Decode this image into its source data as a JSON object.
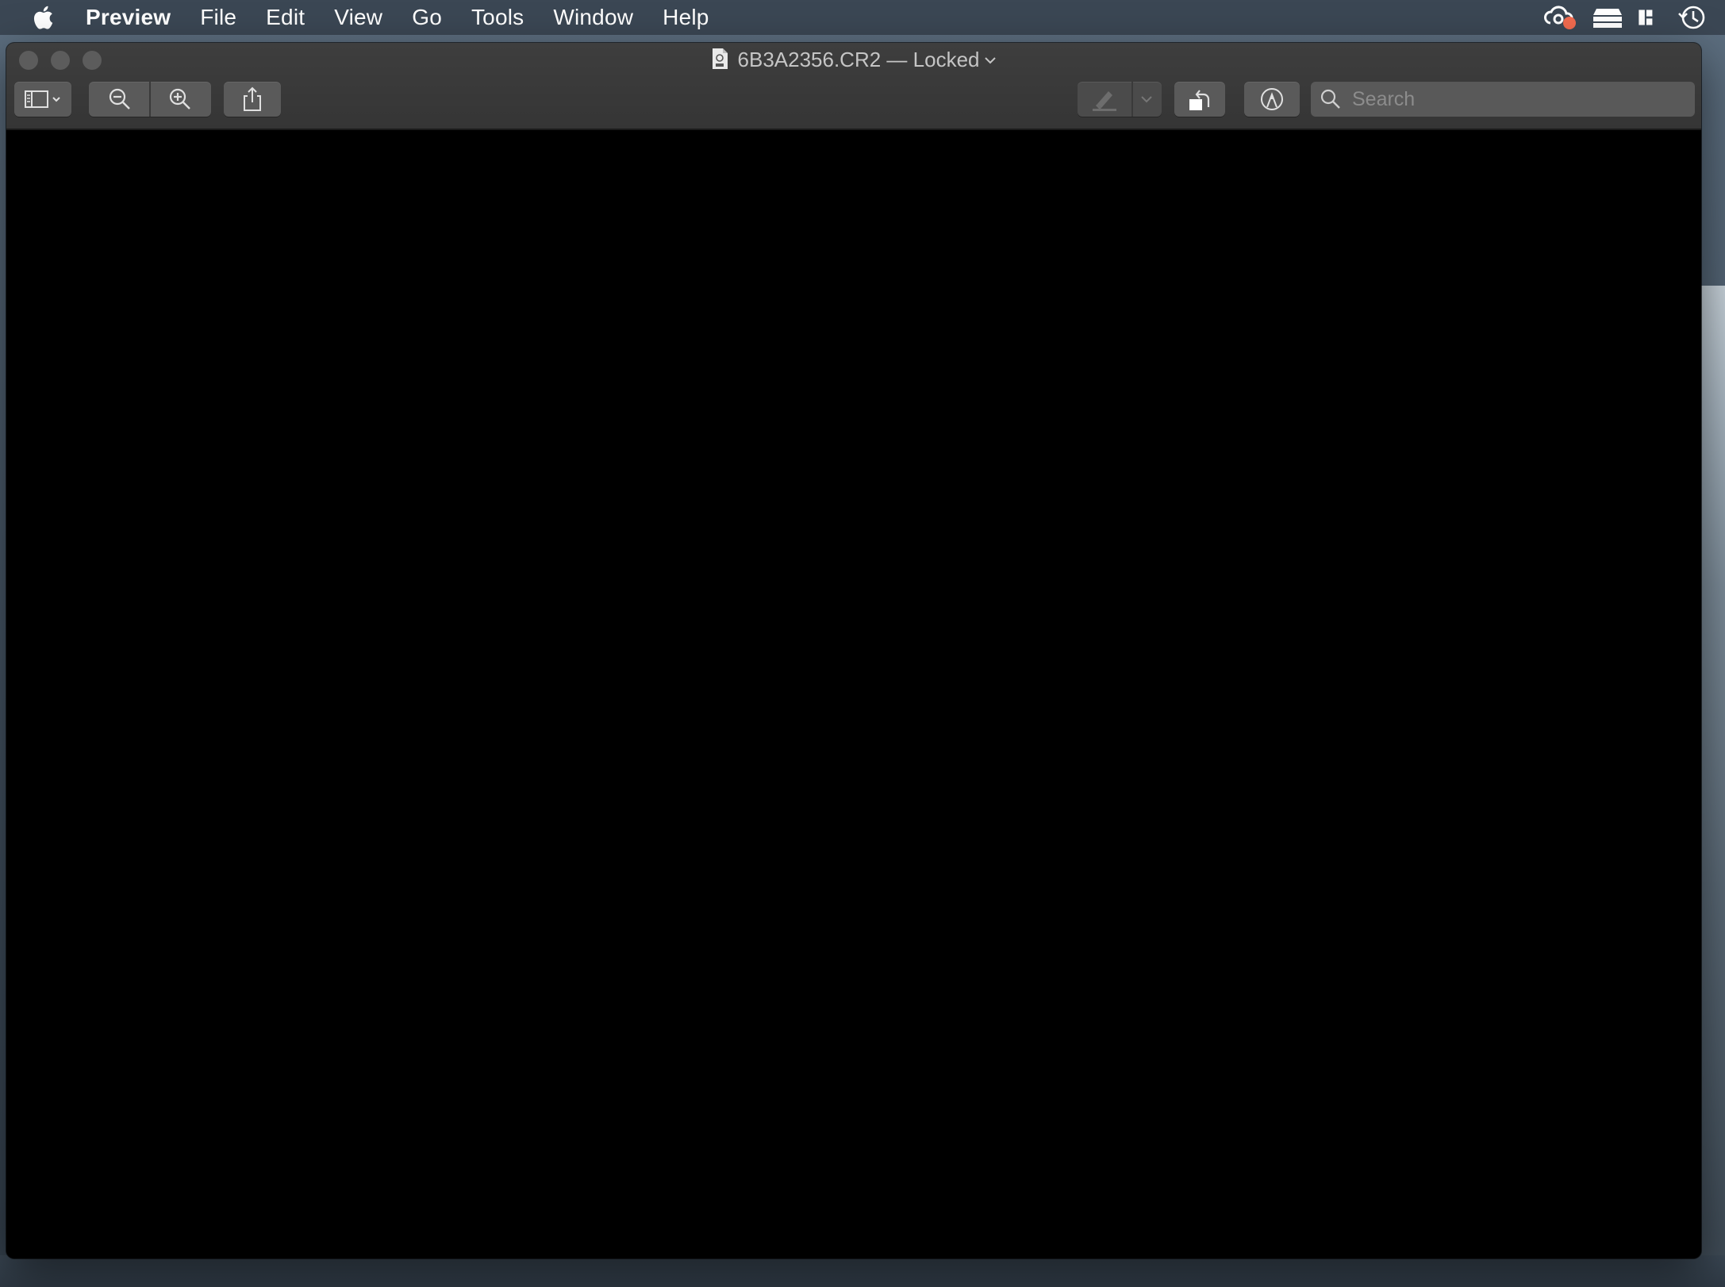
{
  "menubar": {
    "app_name": "Preview",
    "items": [
      "File",
      "Edit",
      "View",
      "Go",
      "Tools",
      "Window",
      "Help"
    ],
    "status_icons": [
      "creative-cloud-icon",
      "dropbox-icon",
      "window-layout-icon",
      "time-machine-icon"
    ]
  },
  "window": {
    "title": "6B3A2356.CR2 — Locked",
    "document_icon": "cr2-document-icon"
  },
  "toolbar": {
    "sidebar_toggle": "sidebar-icon",
    "zoom_out": "zoom-out-icon",
    "zoom_in": "zoom-in-icon",
    "share": "share-icon",
    "highlight": "highlighter-icon",
    "rotate": "rotate-left-icon",
    "markup": "markup-icon"
  },
  "search": {
    "placeholder": "Search",
    "value": ""
  },
  "colors": {
    "notification_badge": "#f26b4f",
    "content_background": "#000000",
    "toolbar_button": "#5a5a5a"
  }
}
